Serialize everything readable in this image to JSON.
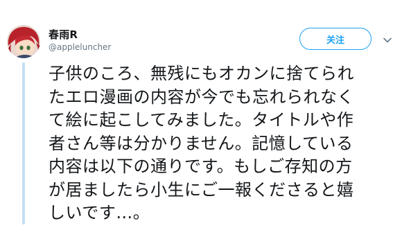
{
  "author": {
    "display_name": "春雨R",
    "handle": "@appleluncher"
  },
  "actions": {
    "follow_label": "关注",
    "more_icon": "chevron-down-icon"
  },
  "tweet": {
    "lines": [
      "子供のころ、無残にもオカンに捨てられ",
      "たエロ漫画の内容が今でも忘れられなく",
      "て絵に起こしてみました。タイトルや作",
      "者さん等は分かりません。記憶している",
      "内容は以下の通りです。もしご存知の方",
      "が居ましたら小生にご一報くださると嬉",
      "しいです…。"
    ]
  },
  "colors": {
    "accent": "#1da1f2",
    "text": "#14171a",
    "secondary_text": "#657786",
    "thread_line": "#c2e0f4"
  }
}
